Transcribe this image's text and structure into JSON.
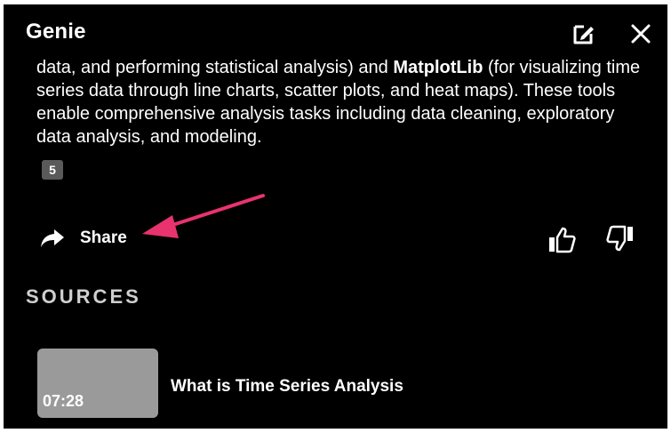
{
  "header": {
    "title": "Genie",
    "edit_icon": "edit-icon",
    "close_icon": "close-icon"
  },
  "answer": {
    "segments": [
      {
        "text": "data, and performing statistical analysis) and ",
        "bold": false
      },
      {
        "text": "MatplotLib",
        "bold": true
      },
      {
        "text": " (for visualizing time series data through line charts, scatter plots, and heat maps). These tools enable comprehensive analysis tasks including data cleaning, exploratory data analysis, and modeling.",
        "bold": false
      }
    ],
    "citation": "5"
  },
  "actions": {
    "share_label": "Share",
    "share_icon": "share-icon",
    "thumbs_up_icon": "thumbs-up-icon",
    "thumbs_down_icon": "thumbs-down-icon"
  },
  "sources": {
    "heading": "SOURCES",
    "items": [
      {
        "duration": "07:28",
        "title": "What is Time Series Analysis"
      }
    ]
  },
  "colors": {
    "background": "#000000",
    "text": "#ffffff",
    "citation_bg": "#5a5a5a",
    "thumbnail": "#9a9a9a",
    "annotation_arrow": "#e8336f"
  }
}
